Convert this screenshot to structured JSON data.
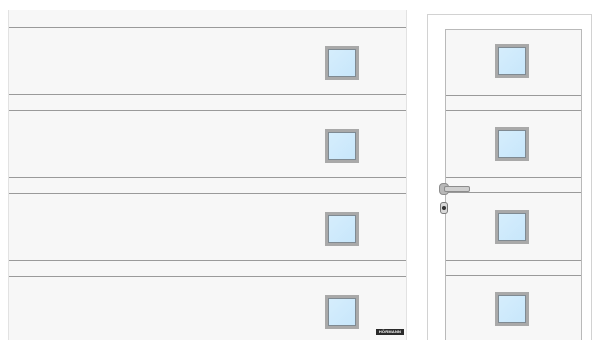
{
  "brand": {
    "logo_text": "HÖRMANN"
  },
  "colors": {
    "panel": "#f7f7f7",
    "groove": "#9a9a9a",
    "glass": "#d6eefc",
    "window_frame": "#a9a9a9"
  },
  "garage_door": {
    "sections": 4,
    "windows_per_section": 1
  },
  "entrance_door": {
    "windows": 4
  }
}
